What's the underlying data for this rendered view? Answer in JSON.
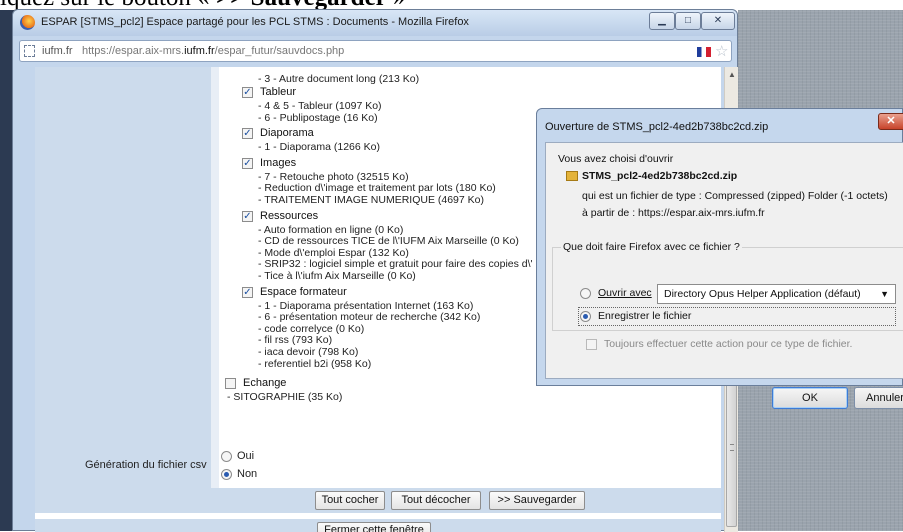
{
  "heading": {
    "prefix": "iquez sur le bouton «",
    "emph": " >> Sauvegarder",
    "suffix": " »"
  },
  "window": {
    "title": "ESPAR [STMS_pcl2] Espace partagé pour les PCL STMS : Documents - Mozilla Firefox",
    "min_icon": "minimize-icon",
    "max_icon": "maximize-icon",
    "close_icon": "close-icon"
  },
  "urlbar": {
    "domain": "iufm.fr",
    "url_prefix": "https://espar.aix-mrs.",
    "url_host": "iufm.fr",
    "url_suffix": "/espar_futur/sauvdocs.php"
  },
  "documents": {
    "top_item": "- 3 - Autre document long (213 Ko)",
    "categories": [
      {
        "label": "Tableur",
        "checked": true,
        "items": [
          "- 4 & 5 - Tableur (1097 Ko)",
          "- 6 - Publipostage (16 Ko)"
        ]
      },
      {
        "label": "Diaporama",
        "checked": true,
        "items": [
          "- 1 - Diaporama (1266 Ko)"
        ]
      },
      {
        "label": "Images",
        "checked": true,
        "items": [
          "- 7 - Retouche photo (32515 Ko)",
          "- Reduction d\\'image et traitement par lots (180 Ko)",
          "- TRAITEMENT IMAGE NUMERIQUE (4697 Ko)"
        ]
      },
      {
        "label": "Ressources",
        "checked": true,
        "items": [
          "- Auto formation en ligne (0 Ko)",
          "- CD de ressources TICE de l\\'IUFM Aix Marseille (0 Ko)",
          "- Mode d\\'emploi Espar (132 Ko)",
          "- SRIP32 : logiciel simple et gratuit pour faire des copies d\\'",
          "- Tice à l\\'iufm Aix Marseille (0 Ko)"
        ]
      },
      {
        "label": "Espace formateur",
        "checked": true,
        "items": [
          "- 1 - Diaporama présentation Internet (163 Ko)",
          "- 6 - présentation moteur de recherche (342 Ko)",
          "- code correlyce (0 Ko)",
          "- fil rss (793 Ko)",
          "- iaca devoir (798 Ko)",
          "- referentiel b2i (958 Ko)"
        ]
      },
      {
        "label": "Echange",
        "checked": false,
        "items": [
          "- SITOGRAPHIE (35 Ko)"
        ]
      }
    ]
  },
  "csv": {
    "label": "Génération du fichier csv",
    "options": [
      {
        "label": "Oui",
        "selected": false
      },
      {
        "label": "Non",
        "selected": true
      }
    ]
  },
  "buttons": {
    "check_all": "Tout cocher",
    "uncheck_all": "Tout décocher",
    "save": ">> Sauvegarder",
    "close_window": "Fermer cette fenêtre"
  },
  "dialog": {
    "title": "Ouverture de STMS_pcl2-4ed2b738bc2cd.zip",
    "intro": "Vous avez choisi d'ouvrir",
    "filename": "STMS_pcl2-4ed2b738bc2cd.zip",
    "type_line": "qui est un fichier de type :  Compressed (zipped) Folder (-1 octets)",
    "from_line": "à partir de :  https://espar.aix-mrs.iufm.fr",
    "question": "Que doit faire Firefox avec ce fichier ?",
    "open_with_label": "Ouvrir avec",
    "open_with_app": "Directory Opus Helper Application (défaut)",
    "save_label": "Enregistrer le fichier",
    "always_label": "Toujours effectuer cette action pour ce type de fichier.",
    "ok": "OK",
    "cancel": "Annuler",
    "selected_option": "save"
  }
}
